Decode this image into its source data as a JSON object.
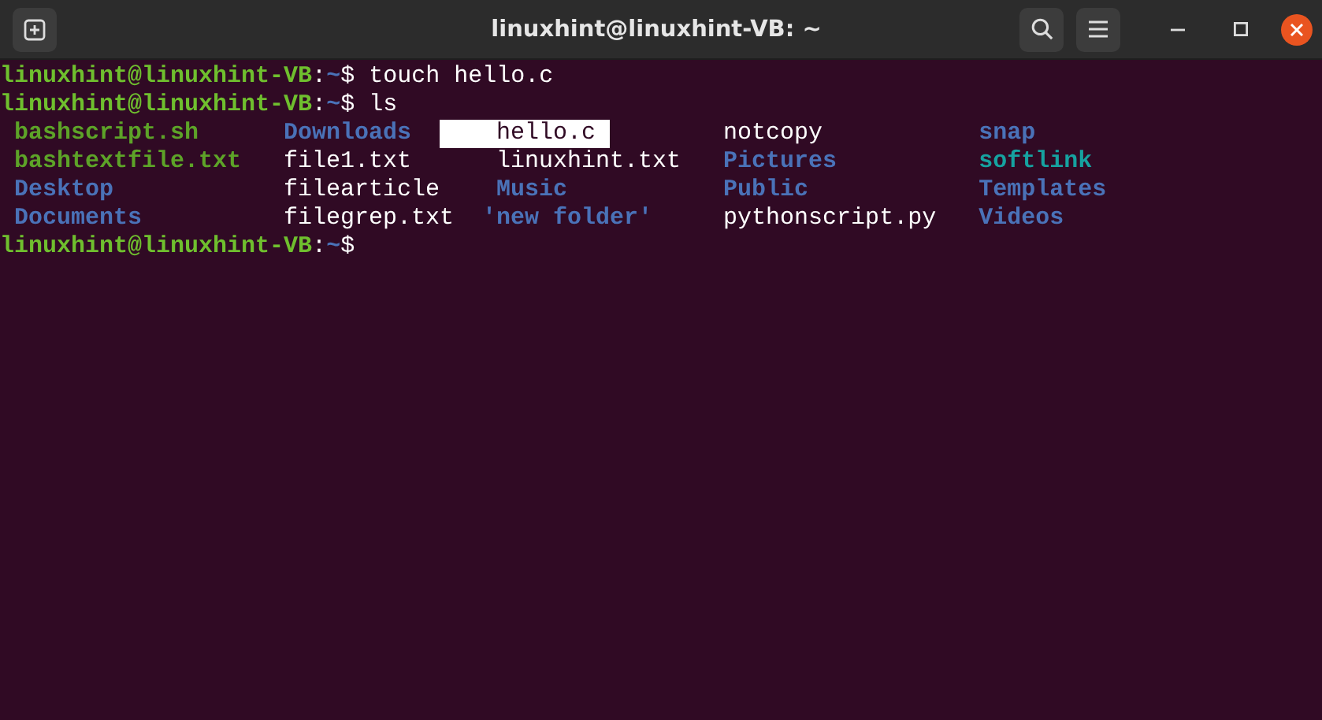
{
  "window": {
    "title": "linuxhint@linuxhint-VB: ~"
  },
  "terminal": {
    "lines": [
      {
        "kind": "prompt",
        "user_host": "linuxhint@linuxhint-VB",
        "separator": ":",
        "path": "~",
        "sign": "$",
        "command": "touch hello.c"
      },
      {
        "kind": "prompt",
        "user_host": "linuxhint@linuxhint-VB",
        "separator": ":",
        "path": "~",
        "sign": "$",
        "command": "ls"
      },
      {
        "kind": "listing",
        "rows": [
          [
            {
              "name": "bashscript.sh",
              "kind": "exec",
              "selected": false
            },
            {
              "name": "Downloads",
              "kind": "dir",
              "selected": false
            },
            {
              "name": "hello.c",
              "kind": "file",
              "selected": true
            },
            {
              "name": "notcopy",
              "kind": "file",
              "selected": false
            },
            {
              "name": "snap",
              "kind": "dir",
              "selected": false
            }
          ],
          [
            {
              "name": "bashtextfile.txt",
              "kind": "exec",
              "selected": false
            },
            {
              "name": "file1.txt",
              "kind": "file",
              "selected": false
            },
            {
              "name": "linuxhint.txt",
              "kind": "file",
              "selected": false
            },
            {
              "name": "Pictures",
              "kind": "dir",
              "selected": false
            },
            {
              "name": "softlink",
              "kind": "link",
              "selected": false
            }
          ],
          [
            {
              "name": "Desktop",
              "kind": "dir",
              "selected": false
            },
            {
              "name": "filearticle",
              "kind": "file",
              "selected": false
            },
            {
              "name": "Music",
              "kind": "dir",
              "selected": false
            },
            {
              "name": "Public",
              "kind": "dir",
              "selected": false
            },
            {
              "name": "Templates",
              "kind": "dir",
              "selected": false
            }
          ],
          [
            {
              "name": "Documents",
              "kind": "dir",
              "selected": false
            },
            {
              "name": "filegrep.txt",
              "kind": "file",
              "selected": false
            },
            {
              "name": "'new folder'",
              "kind": "quoted_dir",
              "selected": false
            },
            {
              "name": "pythonscript.py",
              "kind": "file",
              "selected": false
            },
            {
              "name": "Videos",
              "kind": "dir",
              "selected": false
            }
          ]
        ]
      },
      {
        "kind": "prompt",
        "user_host": "linuxhint@linuxhint-VB",
        "separator": ":",
        "path": "~",
        "sign": "$"
      }
    ]
  }
}
